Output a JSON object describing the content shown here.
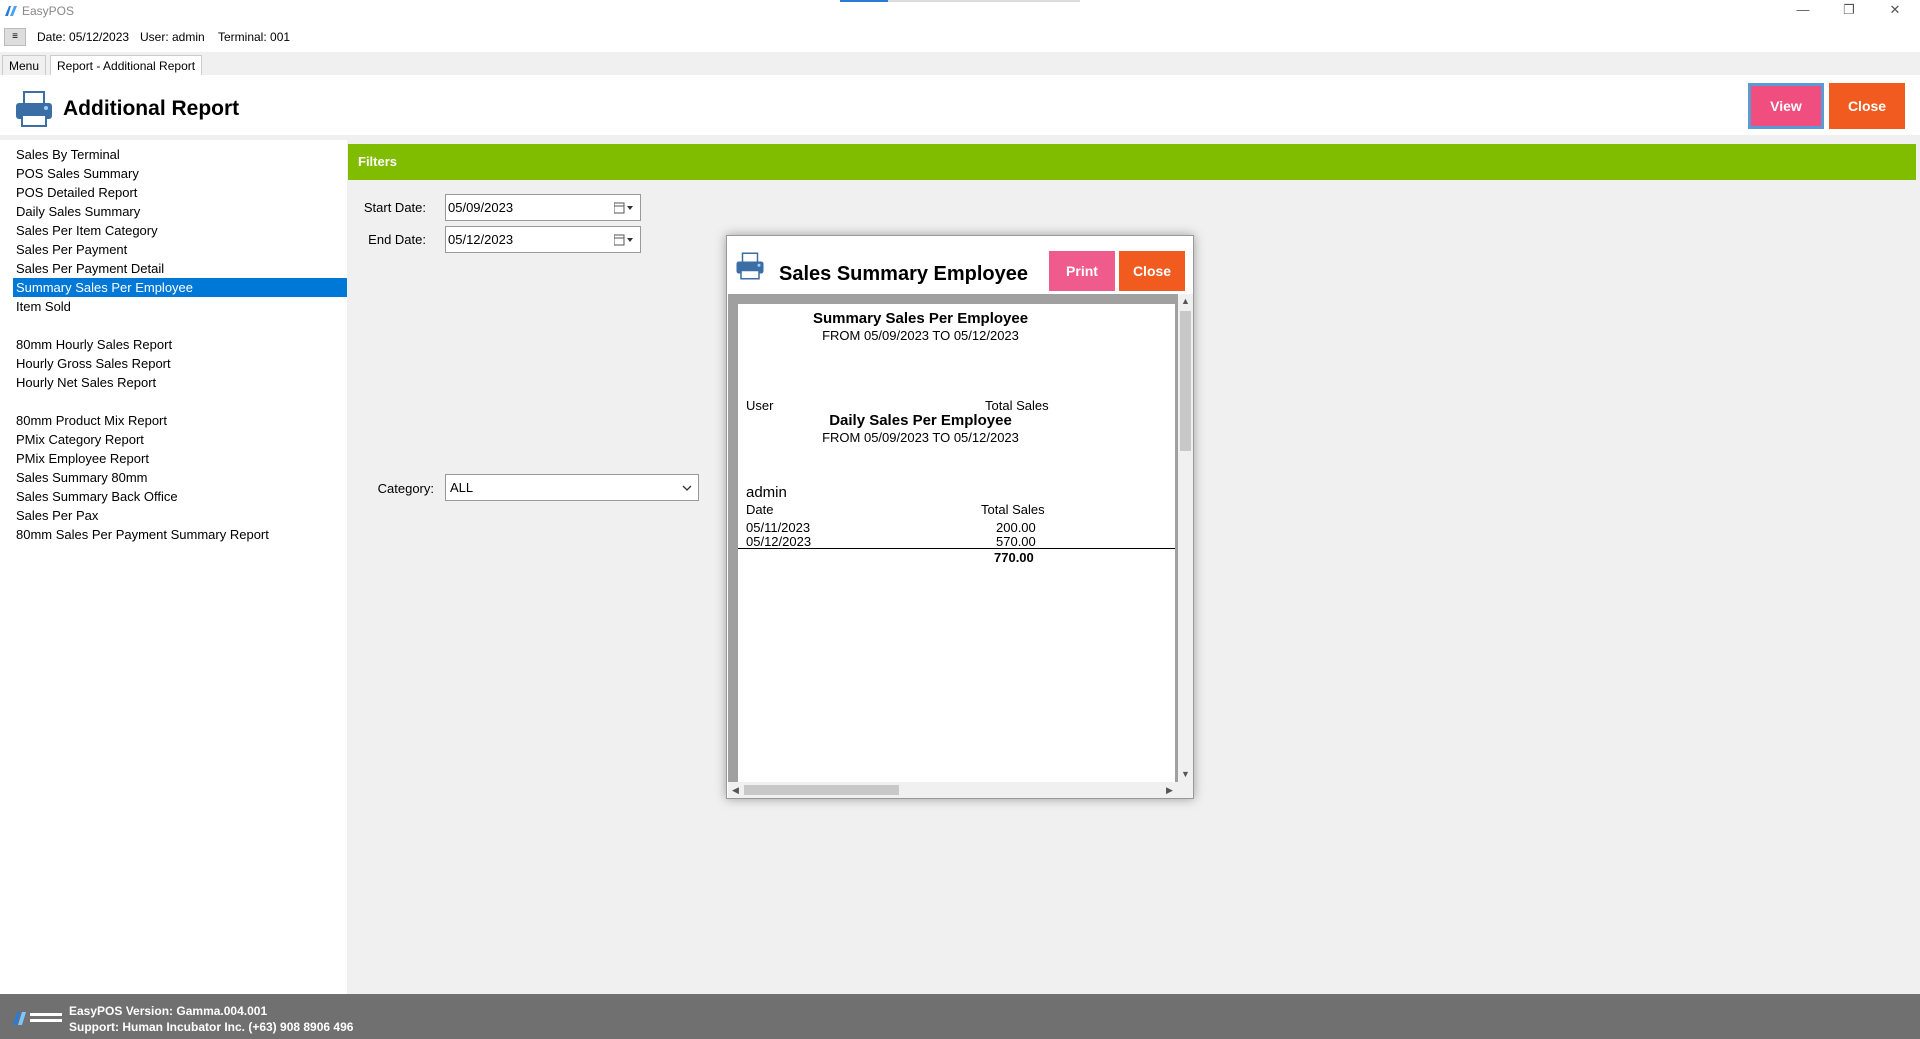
{
  "window": {
    "title": "EasyPOS",
    "minimize_icon": "minimize-icon",
    "restore_icon": "restore-icon",
    "close_icon": "close-icon",
    "minimize": "—",
    "restore": "❐",
    "close": "✕"
  },
  "infobar": {
    "menu_toggle": "≡",
    "date": "Date: 05/12/2023",
    "user": "User: admin",
    "terminal": "Terminal: 001"
  },
  "tabs": [
    {
      "label": "Menu"
    },
    {
      "label": "Report - Additional Report"
    }
  ],
  "page": {
    "title": "Additional Report",
    "view_label": "View",
    "close_label": "Close"
  },
  "reports": [
    "Sales By Terminal",
    "POS Sales Summary",
    "POS Detailed Report",
    "Daily Sales Summary",
    "Sales Per Item Category",
    "Sales Per Payment",
    "Sales Per Payment Detail",
    "Summary Sales Per Employee",
    "Item Sold",
    "80mm Hourly Sales Report",
    "Hourly Gross Sales Report",
    "Hourly Net Sales Report",
    "80mm Product Mix Report",
    "PMix Category Report",
    "PMix Employee Report",
    "Sales Summary 80mm",
    "Sales Summary Back Office",
    "Sales Per Pax",
    "80mm Sales Per Payment Summary Report"
  ],
  "filters": {
    "header": "Filters",
    "start_date_label": "Start Date:",
    "start_date": "05/09/2023",
    "end_date_label": "End Date:",
    "end_date": "05/12/2023",
    "category_label": "Category:",
    "category": "ALL"
  },
  "modal": {
    "title": "Sales Summary Employee",
    "print_label": "Print",
    "close_label": "Close",
    "report": {
      "title": "Summary Sales Per Employee",
      "range": "FROM 05/09/2023 TO 05/12/2023",
      "col_user": "User",
      "col_total": "Total Sales",
      "sub_title": "Daily Sales Per Employee",
      "sub_range": "FROM 05/09/2023 TO 05/12/2023",
      "employee": "admin",
      "col_date": "Date",
      "col_total_sales": "Total Sales",
      "rows": [
        {
          "date": "05/11/2023",
          "total": "200.00"
        },
        {
          "date": "05/12/2023",
          "total": "570.00"
        }
      ],
      "grand_total": "770.00"
    }
  },
  "footer": {
    "version": "EasyPOS Version: Gamma.004.001",
    "support": "Support: Human Incubator Inc. (+63) 908 8906 496"
  },
  "colors": {
    "filters_header": "#80bc00",
    "view_button": "#ef4e7f",
    "close_button": "#f25b20",
    "selection": "#0078d7",
    "footer": "#707070"
  }
}
